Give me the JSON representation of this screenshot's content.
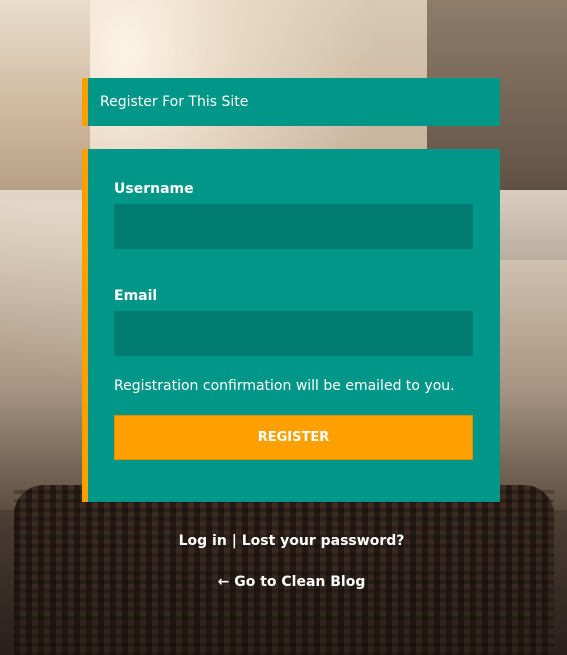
{
  "header": {
    "title": "Register For This Site"
  },
  "form": {
    "username_label": "Username",
    "username_value": "",
    "email_label": "Email",
    "email_value": "",
    "confirmation_text": "Registration confirmation will be emailed to you.",
    "register_label": "Register"
  },
  "links": {
    "login": "Log in",
    "separator": "|",
    "lost_password": "Lost your password?",
    "back_to_site": "← Go to Clean Blog"
  },
  "colors": {
    "panel": "#009688",
    "input": "#007d70",
    "accent": "#ff9f00",
    "text": "#ffffff"
  }
}
